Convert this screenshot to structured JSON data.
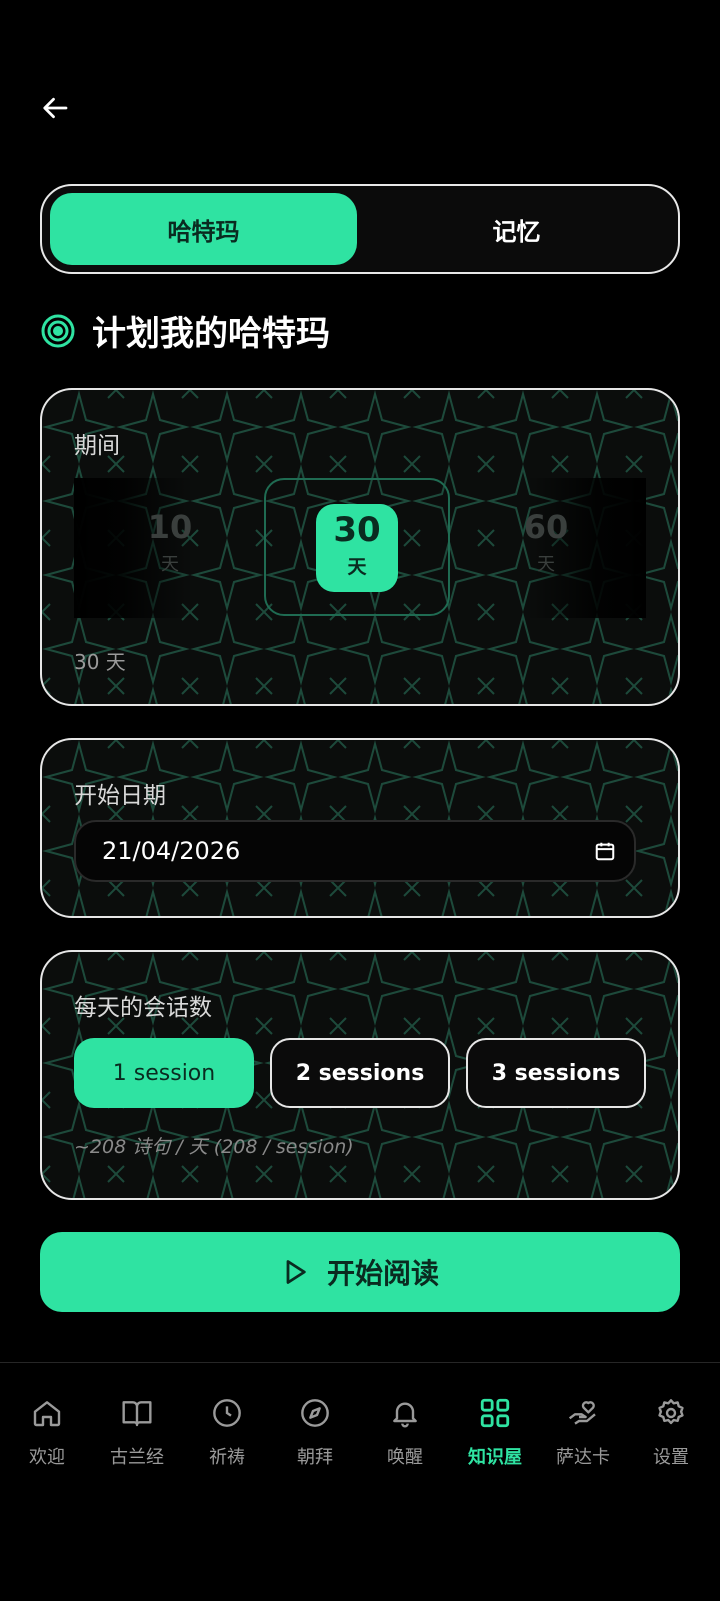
{
  "header": {
    "back_icon": "arrow-left-icon"
  },
  "tabs": [
    {
      "label": "哈特玛",
      "active": true
    },
    {
      "label": "记忆",
      "active": false
    }
  ],
  "title": {
    "icon": "target-icon",
    "text": "计划我的哈特玛"
  },
  "duration": {
    "label": "期间",
    "options": [
      {
        "value": "10",
        "unit": "天"
      },
      {
        "value": "30",
        "unit": "天"
      },
      {
        "value": "60",
        "unit": "天"
      }
    ],
    "selected_index": 1,
    "summary": "30 天"
  },
  "start_date": {
    "label": "开始日期",
    "value": "21/04/2026",
    "icon": "calendar-icon"
  },
  "sessions": {
    "label": "每天的会话数",
    "options": [
      "1 session",
      "2 sessions",
      "3 sessions"
    ],
    "selected_index": 0,
    "hint": "~208 诗句 / 天 (208 / session)"
  },
  "start_button": {
    "label": "开始阅读",
    "icon": "play-icon"
  },
  "bottom_nav": [
    {
      "label": "欢迎",
      "icon": "home-icon"
    },
    {
      "label": "古兰经",
      "icon": "book-icon"
    },
    {
      "label": "祈祷",
      "icon": "clock-icon"
    },
    {
      "label": "朝拜",
      "icon": "compass-icon"
    },
    {
      "label": "唤醒",
      "icon": "bell-icon"
    },
    {
      "label": "知识屋",
      "icon": "grid-icon",
      "active": true
    },
    {
      "label": "萨达卡",
      "icon": "hand-heart-icon"
    },
    {
      "label": "设置",
      "icon": "gear-icon"
    }
  ],
  "colors": {
    "accent": "#2fe3a2",
    "background": "#000000",
    "accent_text": "#0a2b20"
  }
}
